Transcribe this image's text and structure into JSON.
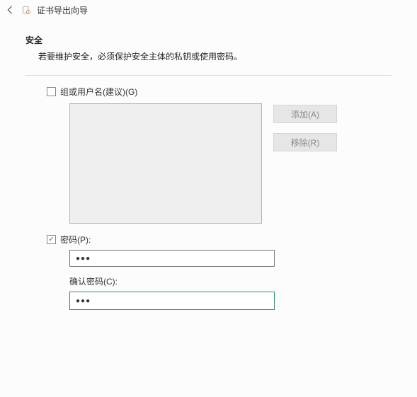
{
  "titlebar": {
    "title": "证书导出向导"
  },
  "security": {
    "heading": "安全",
    "description": "若要维护安全，必须保护安全主体的私钥或使用密码。"
  },
  "groupUsers": {
    "checked": false,
    "label": "组或用户名(建议)(G)"
  },
  "buttons": {
    "add": "添加(A)",
    "remove": "移除(R)"
  },
  "password": {
    "checked": true,
    "label": "密码(P):",
    "value": "●●●",
    "confirmLabel": "确认密码(C):",
    "confirmValue": "●●●"
  }
}
